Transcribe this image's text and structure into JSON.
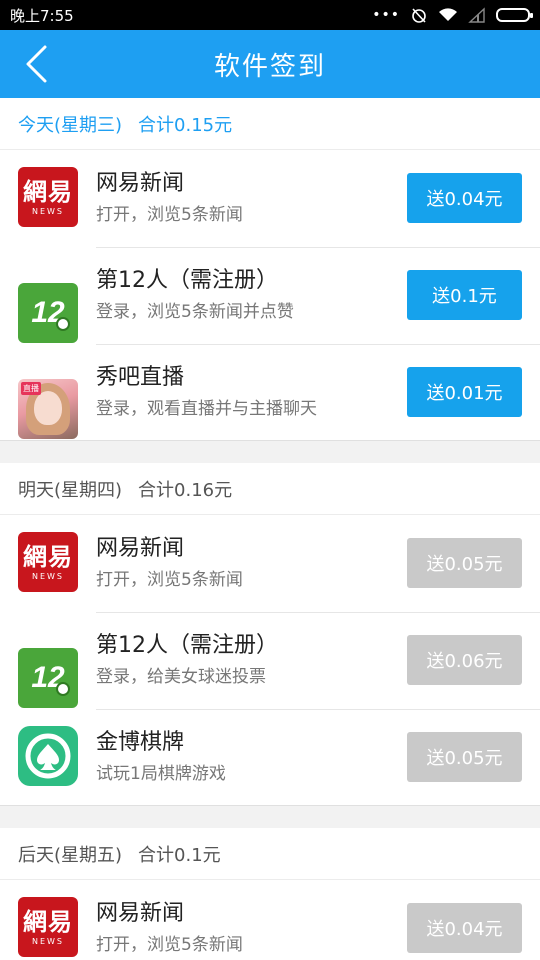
{
  "status": {
    "time": "晚上7:55"
  },
  "header": {
    "title": "软件签到"
  },
  "sections": [
    {
      "day": "今天(星期三)",
      "total": "合计0.15元",
      "items": [
        {
          "name": "网易新闻",
          "task": "打开，浏览5条新闻",
          "reward": "送0.04元",
          "icon": "netease-news-icon"
        },
        {
          "name": "第12人（需注册）",
          "task": "登录，浏览5条新闻并点赞",
          "reward": "送0.1元",
          "icon": "12ren-icon"
        },
        {
          "name": "秀吧直播",
          "task": "登录，观看直播并与主播聊天",
          "reward": "送0.01元",
          "icon": "xiuba-live-icon"
        }
      ]
    },
    {
      "day": "明天(星期四)",
      "total": "合计0.16元",
      "items": [
        {
          "name": "网易新闻",
          "task": "打开，浏览5条新闻",
          "reward": "送0.05元",
          "icon": "netease-news-icon"
        },
        {
          "name": "第12人（需注册）",
          "task": "登录，给美女球迷投票",
          "reward": "送0.06元",
          "icon": "12ren-icon"
        },
        {
          "name": "金博棋牌",
          "task": "试玩1局棋牌游戏",
          "reward": "送0.05元",
          "icon": "jinbo-chess-icon"
        }
      ]
    },
    {
      "day": "后天(星期五)",
      "total": "合计0.1元",
      "items": [
        {
          "name": "网易新闻",
          "task": "打开，浏览5条新闻",
          "reward": "送0.04元",
          "icon": "netease-news-icon"
        }
      ]
    }
  ],
  "icon_text": {
    "netease_main": "網易",
    "netease_sub": "NEWS",
    "twelve": "12",
    "xiuba_tag": "直播"
  },
  "colors": {
    "accent": "#1e9ff2",
    "button_active": "#16a2ec",
    "button_inactive": "#c9c9c9"
  }
}
